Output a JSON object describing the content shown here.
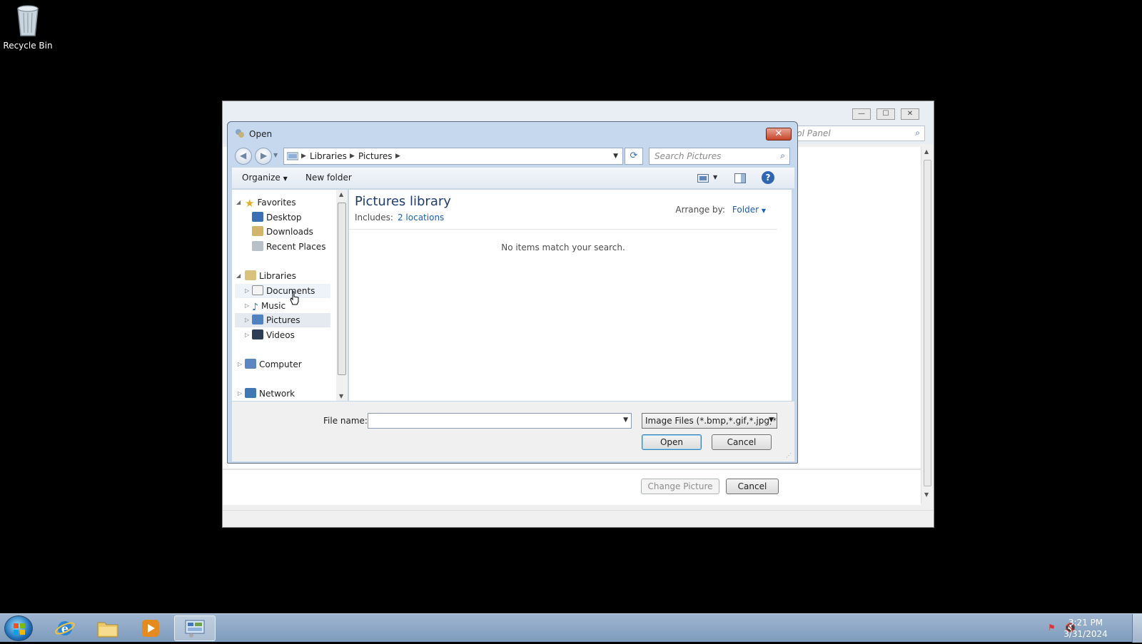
{
  "desktop": {
    "recycle_bin_label": "Recycle Bin"
  },
  "bg_window": {
    "search_placeholder": "ntrol Panel",
    "change_picture_label": "Change Picture",
    "cancel_label": "Cancel"
  },
  "dialog": {
    "title": "Open",
    "close_label": "✕",
    "breadcrumb": [
      "Libraries",
      "Pictures"
    ],
    "search_placeholder": "Search Pictures",
    "toolbar": {
      "organize_label": "Organize",
      "new_folder_label": "New folder"
    },
    "nav": {
      "favorites": "Favorites",
      "desktop": "Desktop",
      "downloads": "Downloads",
      "recent_places": "Recent Places",
      "libraries": "Libraries",
      "documents": "Documents",
      "music": "Music",
      "pictures": "Pictures",
      "videos": "Videos",
      "computer": "Computer",
      "network": "Network"
    },
    "main": {
      "library_title": "Pictures library",
      "includes_label": "Includes:",
      "includes_link": "2 locations",
      "arrange_label": "Arrange by:",
      "arrange_value": "Folder",
      "empty_message": "No items match your search."
    },
    "bottom": {
      "file_name_label": "File name:",
      "file_name_value": "",
      "filter_value": "Image Files (*.bmp,*.gif,*.jpg,*.",
      "open_label": "Open",
      "cancel_label": "Cancel"
    }
  },
  "taskbar": {
    "time": "3:21 PM",
    "date": "3/31/2024"
  },
  "colors": {
    "accent": "#1a5fb4",
    "close_red": "#c7442a",
    "library_title": "#1e3d6d"
  }
}
